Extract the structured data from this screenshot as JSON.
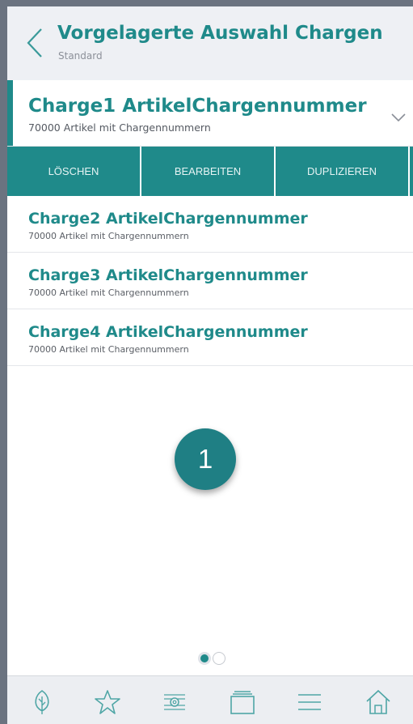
{
  "header": {
    "title": "Vorgelagerte Auswahl Chargen",
    "subtitle": "Standard",
    "back_icon": "chevron-left-icon"
  },
  "selected": {
    "title": "Charge1 ArtikelChargennummer",
    "subtitle": "70000 Artikel mit Chargennummern",
    "expand_icon": "chevron-down-icon"
  },
  "actions": {
    "delete_label": "LÖSCHEN",
    "edit_label": "BEARBEITEN",
    "duplicate_label": "DUPLIZIEREN"
  },
  "list": [
    {
      "title": "Charge2 ArtikelChargennummer",
      "subtitle": "70000 Artikel mit Chargennummern"
    },
    {
      "title": "Charge3 ArtikelChargennummer",
      "subtitle": "70000 Artikel mit Chargennummern"
    },
    {
      "title": "Charge4 ArtikelChargennummer",
      "subtitle": "70000 Artikel mit Chargennummern"
    }
  ],
  "callout": {
    "number": "1"
  },
  "pager": {
    "current_page": 1,
    "total_pages": 2
  },
  "tabbar": {
    "icons": [
      "leaf-icon",
      "star-icon",
      "settings-panel-icon",
      "cards-icon",
      "menu-icon",
      "home-icon"
    ]
  },
  "colors": {
    "accent": "#1f8a8a",
    "header_bg": "#eef0f4",
    "tabbar_bg": "#eceef2",
    "badge": "#1f7f84"
  }
}
